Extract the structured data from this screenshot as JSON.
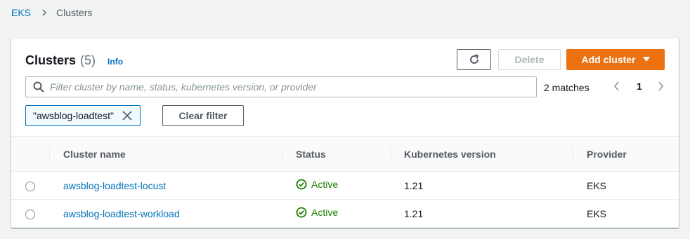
{
  "breadcrumb": {
    "root": "EKS",
    "current": "Clusters"
  },
  "panel": {
    "title": "Clusters",
    "count": "(5)",
    "info_label": "Info",
    "refresh_icon": "refresh-icon",
    "delete_label": "Delete",
    "add_label": "Add cluster",
    "filter_placeholder": "Filter cluster by name, status, kubernetes version, or provider",
    "filter_value": "",
    "matches": "2 matches",
    "current_page": "1",
    "token": "\"awsblog-loadtest\"",
    "clear_label": "Clear filter"
  },
  "table": {
    "columns": [
      "Cluster name",
      "Status",
      "Kubernetes version",
      "Provider"
    ],
    "rows": [
      {
        "name": "awsblog-loadtest-locust",
        "status": "Active",
        "version": "1.21",
        "provider": "EKS"
      },
      {
        "name": "awsblog-loadtest-workload",
        "status": "Active",
        "version": "1.21",
        "provider": "EKS"
      }
    ]
  },
  "colors": {
    "accent": "#0073bb",
    "primary_button": "#ec7211",
    "success": "#1d8102"
  }
}
